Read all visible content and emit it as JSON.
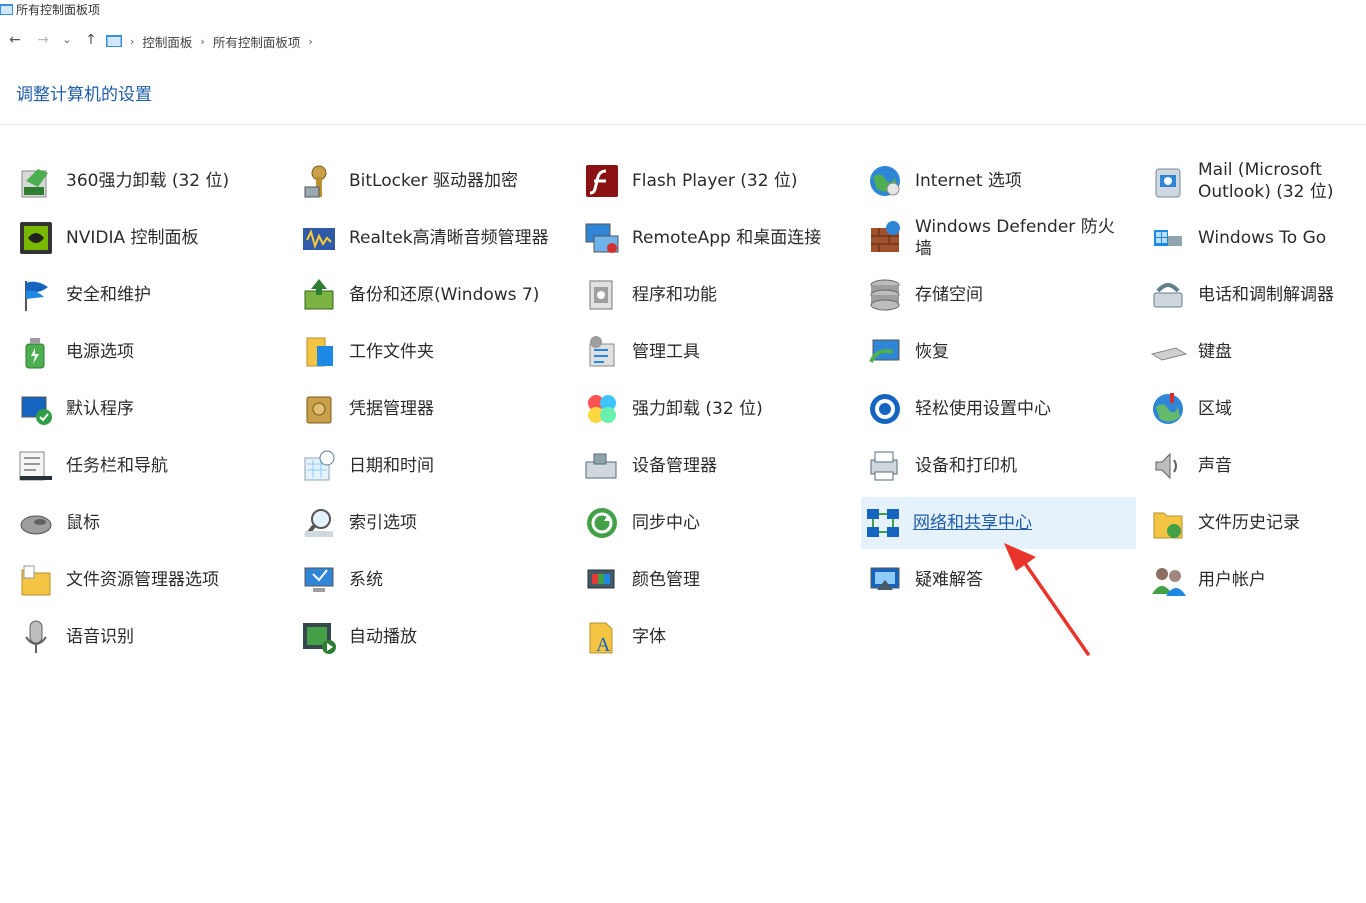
{
  "window": {
    "title": "所有控制面板项"
  },
  "nav": {
    "back_glyph": "←",
    "forward_glyph": "→",
    "recent_glyph": "⌄",
    "up_glyph": "↑",
    "separator": "›",
    "breadcrumbs": [
      "控制面板",
      "所有控制面板项"
    ]
  },
  "page": {
    "title": "调整计算机的设置"
  },
  "items": [
    {
      "label": "360强力卸载 (32 位)",
      "icon": "uninstall-360-icon"
    },
    {
      "label": "BitLocker 驱动器加密",
      "icon": "bitlocker-icon"
    },
    {
      "label": "Flash Player (32 位)",
      "icon": "flash-player-icon"
    },
    {
      "label": "Internet 选项",
      "icon": "internet-options-icon"
    },
    {
      "label": "Mail (Microsoft Outlook) (32 位)",
      "icon": "mail-icon"
    },
    {
      "label": "NVIDIA 控制面板",
      "icon": "nvidia-icon"
    },
    {
      "label": "Realtek高清晰音频管理器",
      "icon": "realtek-audio-icon"
    },
    {
      "label": "RemoteApp 和桌面连接",
      "icon": "remoteapp-icon"
    },
    {
      "label": "Windows Defender 防火墙",
      "icon": "firewall-icon"
    },
    {
      "label": "Windows To Go",
      "icon": "windows-to-go-icon"
    },
    {
      "label": "安全和维护",
      "icon": "security-flag-icon"
    },
    {
      "label": "备份和还原(Windows 7)",
      "icon": "backup-icon"
    },
    {
      "label": "程序和功能",
      "icon": "programs-icon"
    },
    {
      "label": "存储空间",
      "icon": "storage-spaces-icon"
    },
    {
      "label": "电话和调制解调器",
      "icon": "phone-modem-icon"
    },
    {
      "label": "电源选项",
      "icon": "power-options-icon"
    },
    {
      "label": "工作文件夹",
      "icon": "work-folders-icon"
    },
    {
      "label": "管理工具",
      "icon": "admin-tools-icon"
    },
    {
      "label": "恢复",
      "icon": "recovery-icon"
    },
    {
      "label": "键盘",
      "icon": "keyboard-icon"
    },
    {
      "label": "默认程序",
      "icon": "default-programs-icon"
    },
    {
      "label": "凭据管理器",
      "icon": "credential-manager-icon"
    },
    {
      "label": "强力卸载 (32 位)",
      "icon": "clover-uninstall-icon"
    },
    {
      "label": "轻松使用设置中心",
      "icon": "ease-of-access-icon"
    },
    {
      "label": "区域",
      "icon": "region-icon"
    },
    {
      "label": "任务栏和导航",
      "icon": "taskbar-icon"
    },
    {
      "label": "日期和时间",
      "icon": "date-time-icon"
    },
    {
      "label": "设备管理器",
      "icon": "device-manager-icon"
    },
    {
      "label": "设备和打印机",
      "icon": "devices-printers-icon"
    },
    {
      "label": "声音",
      "icon": "sound-icon"
    },
    {
      "label": "鼠标",
      "icon": "mouse-icon"
    },
    {
      "label": "索引选项",
      "icon": "indexing-icon"
    },
    {
      "label": "同步中心",
      "icon": "sync-center-icon"
    },
    {
      "label": "网络和共享中心",
      "icon": "network-sharing-icon",
      "selected": true
    },
    {
      "label": "文件历史记录",
      "icon": "file-history-icon"
    },
    {
      "label": "文件资源管理器选项",
      "icon": "explorer-options-icon"
    },
    {
      "label": "系统",
      "icon": "system-icon"
    },
    {
      "label": "颜色管理",
      "icon": "color-management-icon"
    },
    {
      "label": "疑难解答",
      "icon": "troubleshooting-icon"
    },
    {
      "label": "用户帐户",
      "icon": "user-accounts-icon"
    },
    {
      "label": "语音识别",
      "icon": "speech-recognition-icon"
    },
    {
      "label": "自动播放",
      "icon": "autoplay-icon"
    },
    {
      "label": "字体",
      "icon": "fonts-icon"
    }
  ],
  "colors": {
    "accent": "#1f5da8",
    "selection": "#e5f1fb",
    "arrow": "#e8342a"
  }
}
